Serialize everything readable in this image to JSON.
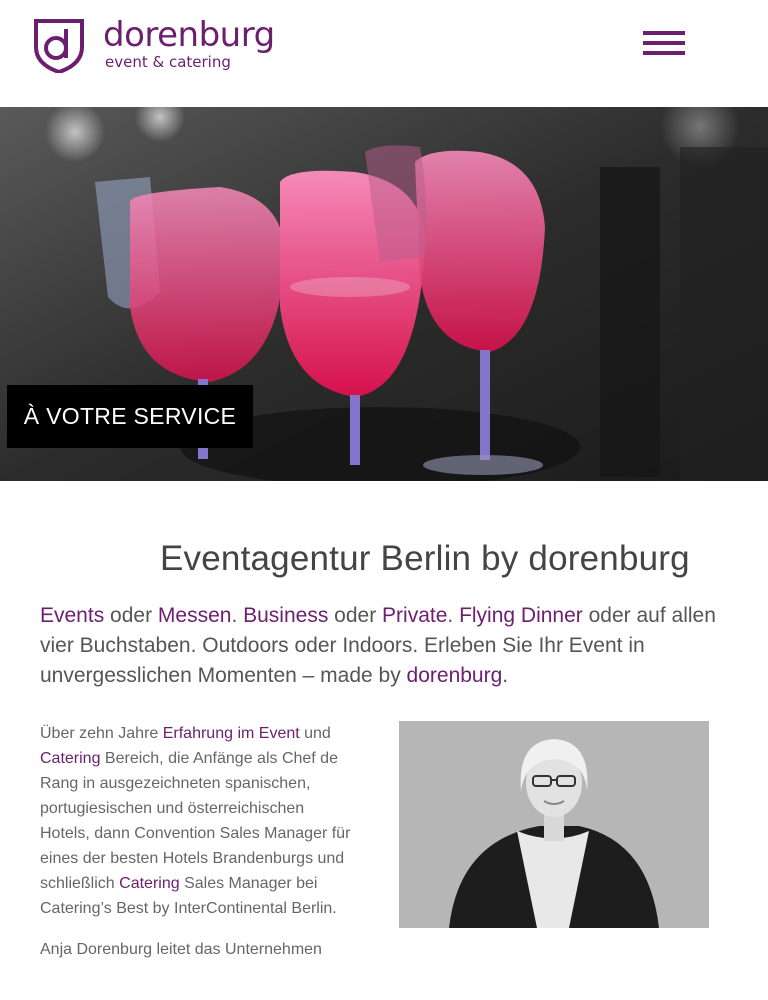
{
  "header": {
    "brand": "dorenburg",
    "tagline": "event & catering",
    "logo_letter": "d",
    "menu_icon": "hamburger-menu-icon"
  },
  "hero": {
    "cta_label": "À VOTRE SERVICE"
  },
  "main": {
    "title": "Eventagentur Berlin by dorenburg",
    "intro": [
      {
        "t": "Events",
        "hl": true
      },
      {
        "t": " oder ",
        "hl": false
      },
      {
        "t": "Messen",
        "hl": true
      },
      {
        "t": ". ",
        "hl": false
      },
      {
        "t": "Business",
        "hl": true
      },
      {
        "t": " oder ",
        "hl": false
      },
      {
        "t": "Private",
        "hl": true
      },
      {
        "t": ". ",
        "hl": false
      },
      {
        "t": "Flying Dinner",
        "hl": true
      },
      {
        "t": " oder auf allen vier Buchstaben. Outdoors oder Indoors. Erleben Sie Ihr Event in unvergesslichen Momenten – made by ",
        "hl": false
      },
      {
        "t": "dorenburg",
        "hl": true
      },
      {
        "t": ".",
        "hl": false
      }
    ],
    "bio_paragraphs": [
      [
        {
          "t": "Über zehn Jahre ",
          "hl": false
        },
        {
          "t": "Erfahrung im Event",
          "hl": true
        },
        {
          "t": " und ",
          "hl": false
        },
        {
          "t": "Catering",
          "hl": true
        },
        {
          "t": " Bereich, die Anfänge als Chef de Rang in ausgezeichneten spanischen, portugiesischen und österreichischen Hotels, dann Convention Sales Manager für eines der besten Hotels Brandenburgs und schließlich ",
          "hl": false
        },
        {
          "t": "Catering",
          "hl": true
        },
        {
          "t": " Sales Manager bei Catering’s Best by InterContinental Berlin.",
          "hl": false
        }
      ],
      [
        {
          "t": "Anja Dorenburg leitet das Unternehmen",
          "hl": false
        }
      ]
    ]
  },
  "colors": {
    "brand": "#6b1f6e",
    "cta_bg": "#000000",
    "cta_text": "#ffffff"
  }
}
